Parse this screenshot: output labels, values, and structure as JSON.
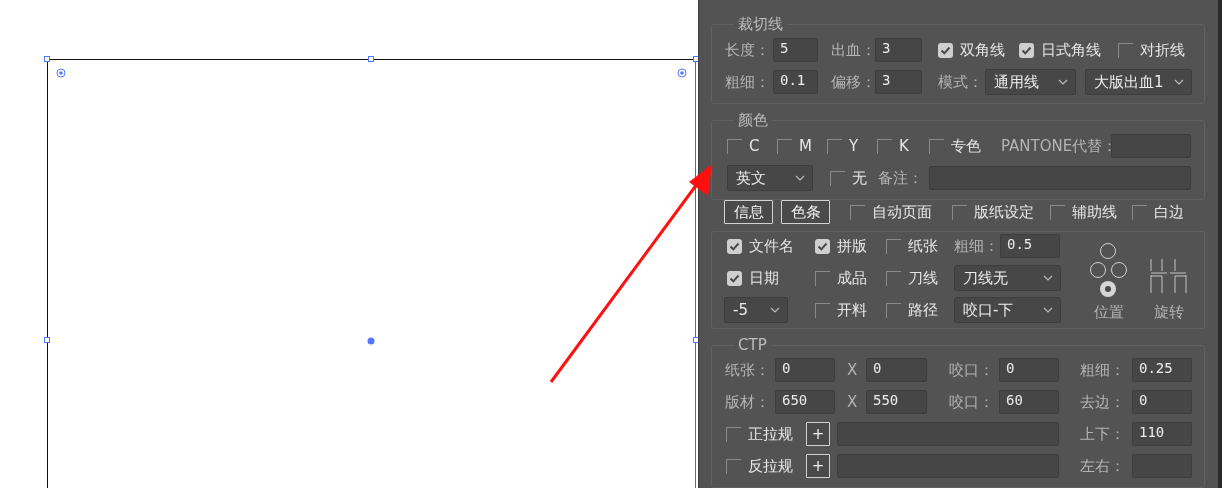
{
  "panel": {
    "blocks": [
      {
        "kind": "group",
        "title": "裁切线",
        "lines": [
          {
            "controls": [
              {
                "kind": "label",
                "text": "长度："
              },
              {
                "kind": "field",
                "value": "5"
              },
              {
                "kind": "label",
                "text": "出血："
              },
              {
                "kind": "field",
                "value": "3"
              },
              {
                "kind": "check",
                "label": "双角线",
                "checked": true
              },
              {
                "kind": "check",
                "label": "日式角线",
                "checked": true
              },
              {
                "kind": "check",
                "label": "对折线",
                "checked": false
              }
            ]
          },
          {
            "controls": [
              {
                "kind": "label",
                "text": "粗细："
              },
              {
                "kind": "field",
                "value": "0.1"
              },
              {
                "kind": "label",
                "text": "偏移："
              },
              {
                "kind": "field",
                "value": "3"
              },
              {
                "kind": "label",
                "text": "模式："
              },
              {
                "kind": "select",
                "value": "通用线"
              },
              {
                "kind": "select",
                "value": "大版出血1"
              }
            ]
          }
        ]
      },
      {
        "kind": "group",
        "title": "颜色",
        "lines": [
          {
            "controls": [
              {
                "kind": "check",
                "label": "C",
                "checked": false
              },
              {
                "kind": "check",
                "label": "M",
                "checked": false
              },
              {
                "kind": "check",
                "label": "Y",
                "checked": false
              },
              {
                "kind": "check",
                "label": "K",
                "checked": false
              },
              {
                "kind": "check",
                "label": "专色",
                "checked": false
              },
              {
                "kind": "label",
                "text": "PANTONE代替："
              },
              {
                "kind": "field"
              }
            ]
          },
          {
            "controls": [
              {
                "kind": "select",
                "value": "英文"
              },
              {
                "kind": "check",
                "label": "无",
                "checked": false
              },
              {
                "kind": "label",
                "text": "备注："
              },
              {
                "kind": "field"
              }
            ]
          }
        ]
      },
      {
        "kind": "bar",
        "lines": [
          {
            "controls": [
              {
                "kind": "button",
                "label": "信息"
              },
              {
                "kind": "button",
                "label": "色条"
              },
              {
                "kind": "check",
                "label": "自动页面",
                "checked": false
              },
              {
                "kind": "check",
                "label": "版纸设定",
                "checked": false
              },
              {
                "kind": "check",
                "label": "辅助线",
                "checked": false
              },
              {
                "kind": "check",
                "label": "白边",
                "checked": false
              }
            ]
          }
        ]
      },
      {
        "kind": "marks",
        "lines": [
          {
            "controls": [
              {
                "kind": "check",
                "label": "文件名",
                "checked": true
              },
              {
                "kind": "check",
                "label": "拼版",
                "checked": true
              },
              {
                "kind": "check",
                "label": "纸张",
                "checked": false
              },
              {
                "kind": "label",
                "text": "粗细："
              },
              {
                "kind": "field",
                "value": "0.5"
              }
            ]
          },
          {
            "controls": [
              {
                "kind": "check",
                "label": "日期",
                "checked": true
              },
              {
                "kind": "check",
                "label": "成品",
                "checked": false
              },
              {
                "kind": "check",
                "label": "刀线",
                "checked": false
              },
              {
                "kind": "select",
                "value": "刀线无"
              }
            ]
          },
          {
            "controls": [
              {
                "kind": "select",
                "value": "-5"
              },
              {
                "kind": "check",
                "label": "开料",
                "checked": false
              },
              {
                "kind": "check",
                "label": "路径",
                "checked": false
              },
              {
                "kind": "select",
                "value": "咬口-下"
              }
            ]
          }
        ],
        "position": {
          "label": "位置",
          "slots": [
            {
              "selected": false
            },
            {
              "selected": false
            },
            {
              "selected": false
            },
            {
              "selected": true
            }
          ]
        },
        "rotate": {
          "label": "旋转"
        }
      },
      {
        "kind": "group",
        "title": "CTP",
        "lines": [
          {
            "controls": [
              {
                "kind": "label",
                "text": "纸张："
              },
              {
                "kind": "field",
                "value": "0"
              },
              {
                "kind": "label",
                "text": "X"
              },
              {
                "kind": "field",
                "value": "0"
              },
              {
                "kind": "label",
                "text": "咬口："
              },
              {
                "kind": "field",
                "value": "0"
              },
              {
                "kind": "label",
                "text": "粗细："
              },
              {
                "kind": "field",
                "value": "0.25"
              }
            ]
          },
          {
            "controls": [
              {
                "kind": "label",
                "text": "版材："
              },
              {
                "kind": "field",
                "value": "650"
              },
              {
                "kind": "label",
                "text": "X"
              },
              {
                "kind": "field",
                "value": "550"
              },
              {
                "kind": "label",
                "text": "咬口："
              },
              {
                "kind": "field",
                "value": "60"
              },
              {
                "kind": "label",
                "text": "去边："
              },
              {
                "kind": "field",
                "value": "0"
              }
            ]
          },
          {
            "controls": [
              {
                "kind": "check",
                "label": "正拉规",
                "checked": false
              },
              {
                "kind": "button",
                "label": "+"
              },
              {
                "kind": "field"
              },
              {
                "kind": "label",
                "text": "上下："
              },
              {
                "kind": "field",
                "value": "110"
              }
            ]
          },
          {
            "controls": [
              {
                "kind": "check",
                "label": "反拉规",
                "checked": false
              },
              {
                "kind": "button",
                "label": "+"
              },
              {
                "kind": "field"
              },
              {
                "kind": "label",
                "text": "左右："
              },
              {
                "kind": "field"
              }
            ]
          }
        ]
      }
    ]
  }
}
